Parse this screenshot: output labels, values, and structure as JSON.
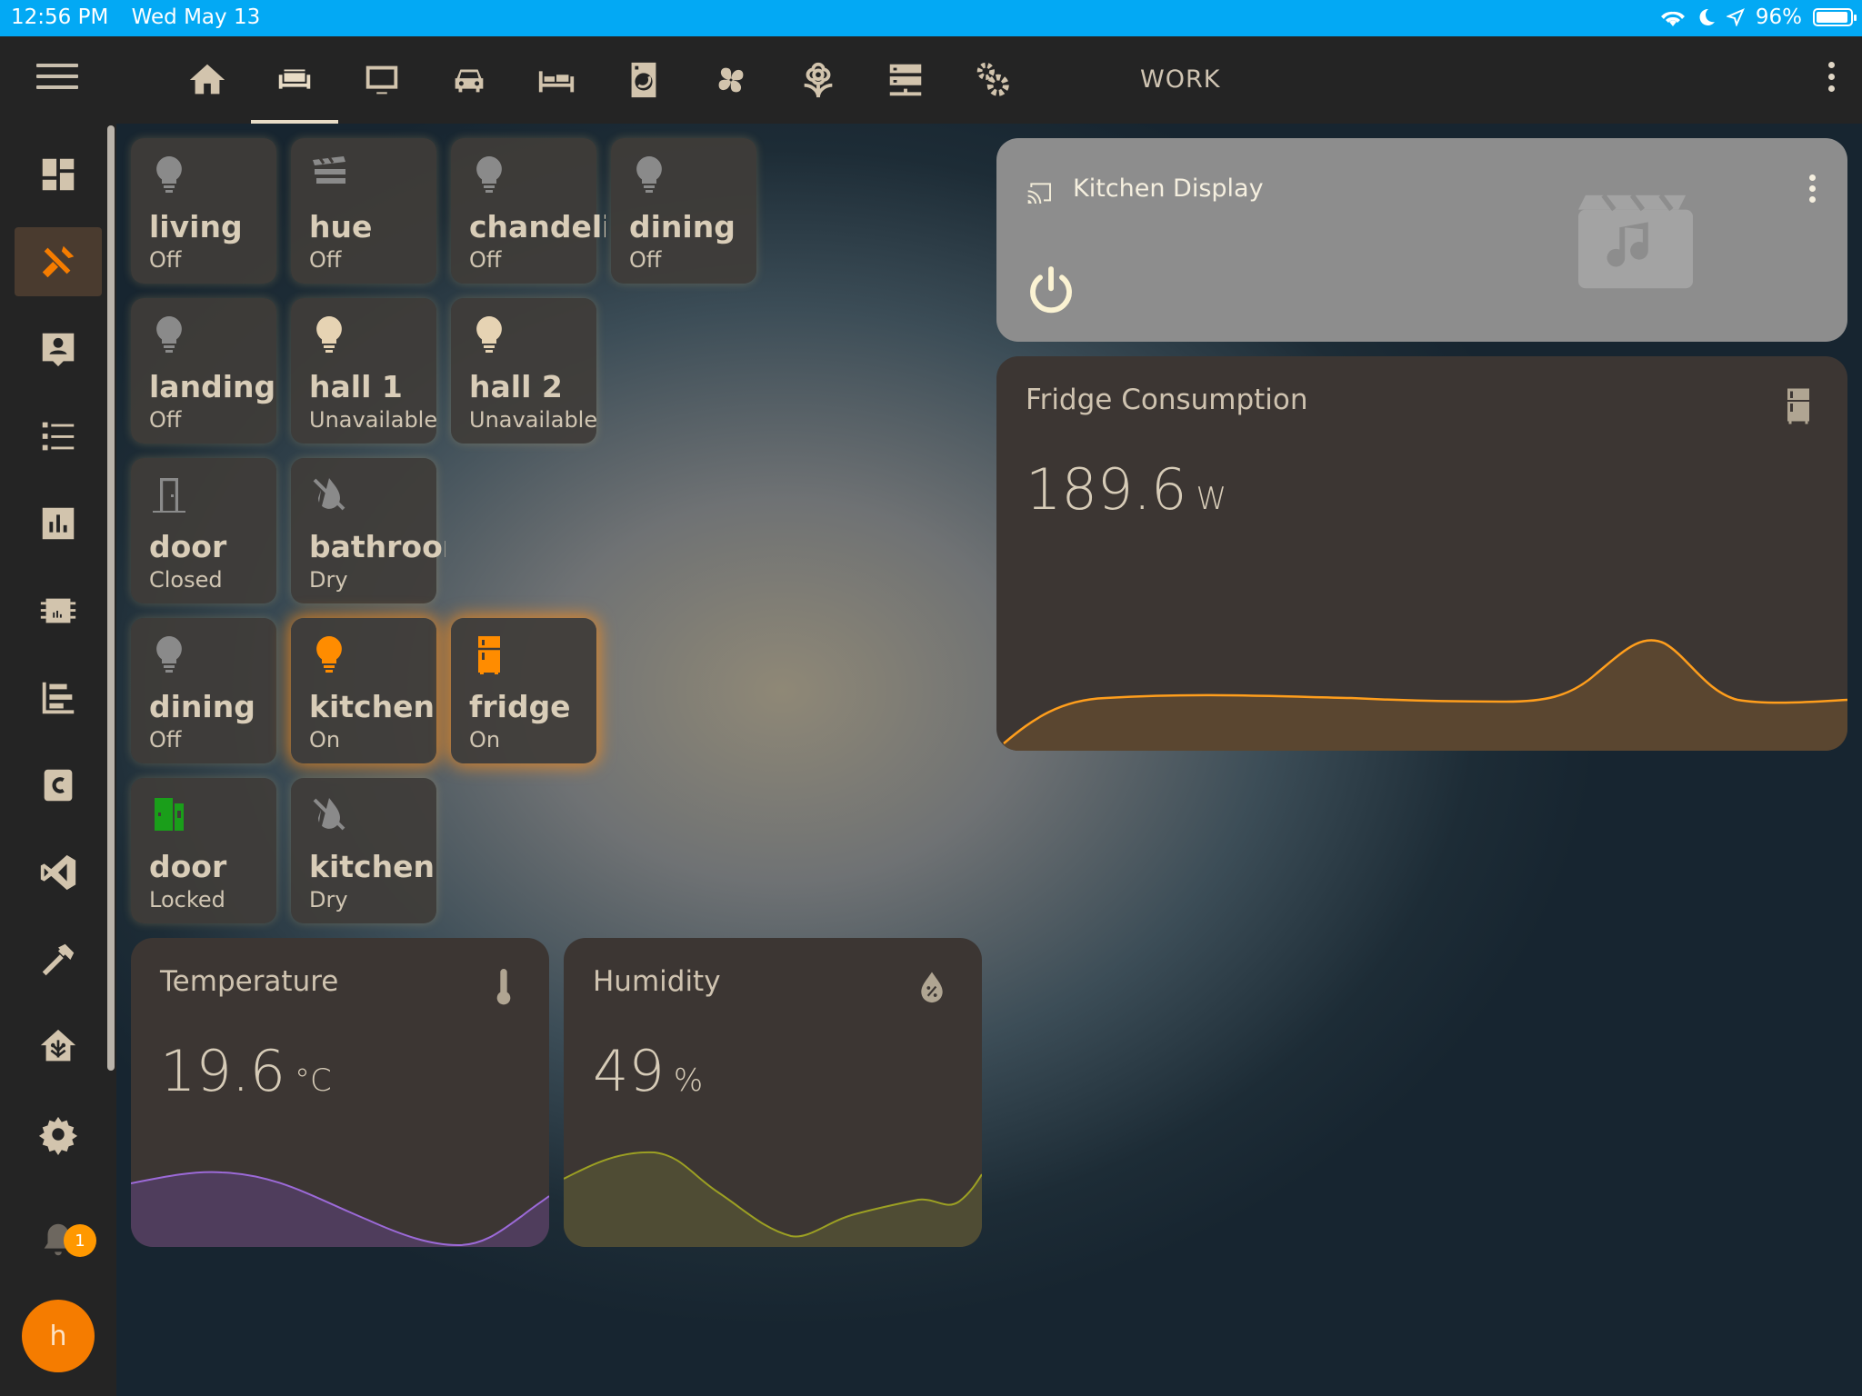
{
  "status_bar": {
    "time": "12:56 PM",
    "date": "Wed May 13",
    "battery": "96%"
  },
  "topbar": {
    "tabs": [
      {
        "icon": "home-icon"
      },
      {
        "icon": "sofa-icon",
        "active": true
      },
      {
        "icon": "monitor-icon"
      },
      {
        "icon": "car-icon"
      },
      {
        "icon": "bed-icon"
      },
      {
        "icon": "washing-machine-icon"
      },
      {
        "icon": "fan-icon"
      },
      {
        "icon": "flower-icon"
      },
      {
        "icon": "server-icon"
      },
      {
        "icon": "cogs-icon"
      }
    ],
    "text_tab": "WORK"
  },
  "sidebar": {
    "items": [
      "dashboard-icon",
      "tools-icon",
      "account-box-icon",
      "list-icon",
      "chart-icon",
      "chip-icon",
      "tree-list-icon",
      "c-icon",
      "vscode-icon",
      "hammer-icon",
      "home-assistant-icon",
      "settings-icon"
    ],
    "notification_count": "1",
    "avatar_letter": "h"
  },
  "tiles": [
    {
      "name": "living",
      "state": "Off"
    },
    {
      "name": "hue",
      "state": "Off"
    },
    {
      "name": "chandeli.",
      "state": "Off"
    },
    {
      "name": "dining",
      "state": "Off"
    },
    {
      "name": "landing",
      "state": "Off"
    },
    {
      "name": "hall 1",
      "state": "Unavailable"
    },
    {
      "name": "hall 2",
      "state": "Unavailable"
    },
    {
      "name": "door",
      "state": "Closed"
    },
    {
      "name": "bathroom",
      "state": "Dry"
    },
    {
      "name": "dining",
      "state": "Off"
    },
    {
      "name": "kitchen",
      "state": "On"
    },
    {
      "name": "fridge",
      "state": "On"
    },
    {
      "name": "door",
      "state": "Locked"
    },
    {
      "name": "kitchen",
      "state": "Dry"
    }
  ],
  "media": {
    "title": "Kitchen Display"
  },
  "fridge": {
    "title": "Fridge Consumption",
    "value": "189.6",
    "unit": "W"
  },
  "temperature": {
    "title": "Temperature",
    "value": "19.6",
    "unit": "°C"
  },
  "humidity": {
    "title": "Humidity",
    "value": "49",
    "unit": "%"
  },
  "colors": {
    "accent": "#ff8c00",
    "status_bar": "#03a9f4",
    "tile_off_icon": "#8a8a8a",
    "locked_green": "#1a9e1a",
    "temp_graph": "#9c6ad8",
    "humidity_graph": "#9ca023"
  }
}
